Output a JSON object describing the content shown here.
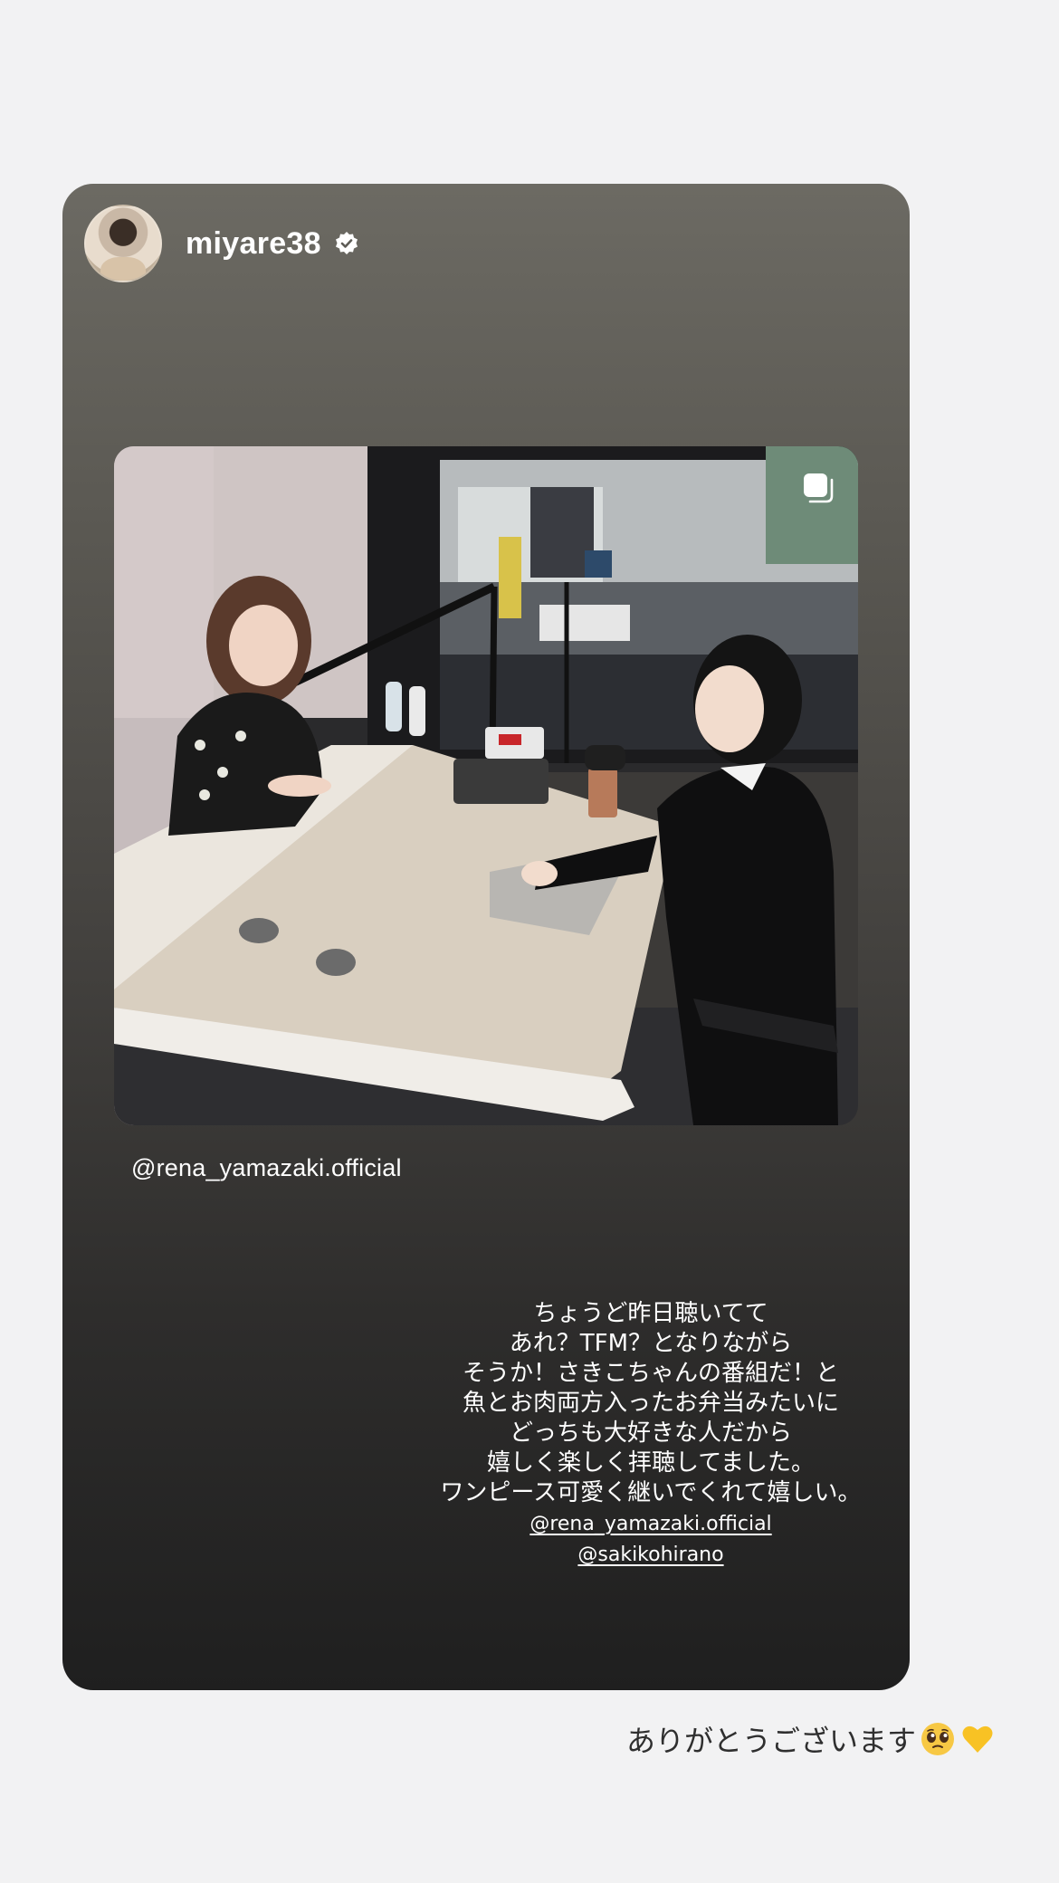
{
  "shared_story": {
    "username": "miyare38",
    "verified": true,
    "mention": "@rena_yamazaki.official",
    "caption_lines": [
      "ちょうど昨日聴いてて",
      "あれ？TFM？となりながら",
      "そうか！さきこちゃんの番組だ！と",
      "魚とお肉両方入ったお弁当みたいに",
      "どっちも大好きな人だから",
      "嬉しく楽しく拝聴してました。",
      "ワンピース可愛く継いでくれて嬉しい。"
    ],
    "caption_tags": [
      "@rena_yamazaki.official",
      "@sakikohirano"
    ],
    "photo_description_icon": "multiple-photos-icon"
  },
  "reply": {
    "text": "ありがとうございます",
    "emojis": [
      "pleading-face-emoji",
      "yellow-heart-emoji"
    ]
  },
  "colors": {
    "background": "#f2f2f3",
    "card_top": "#6c6a63",
    "card_bottom": "#1f1f1f",
    "reply_text": "#2f2f2f"
  }
}
